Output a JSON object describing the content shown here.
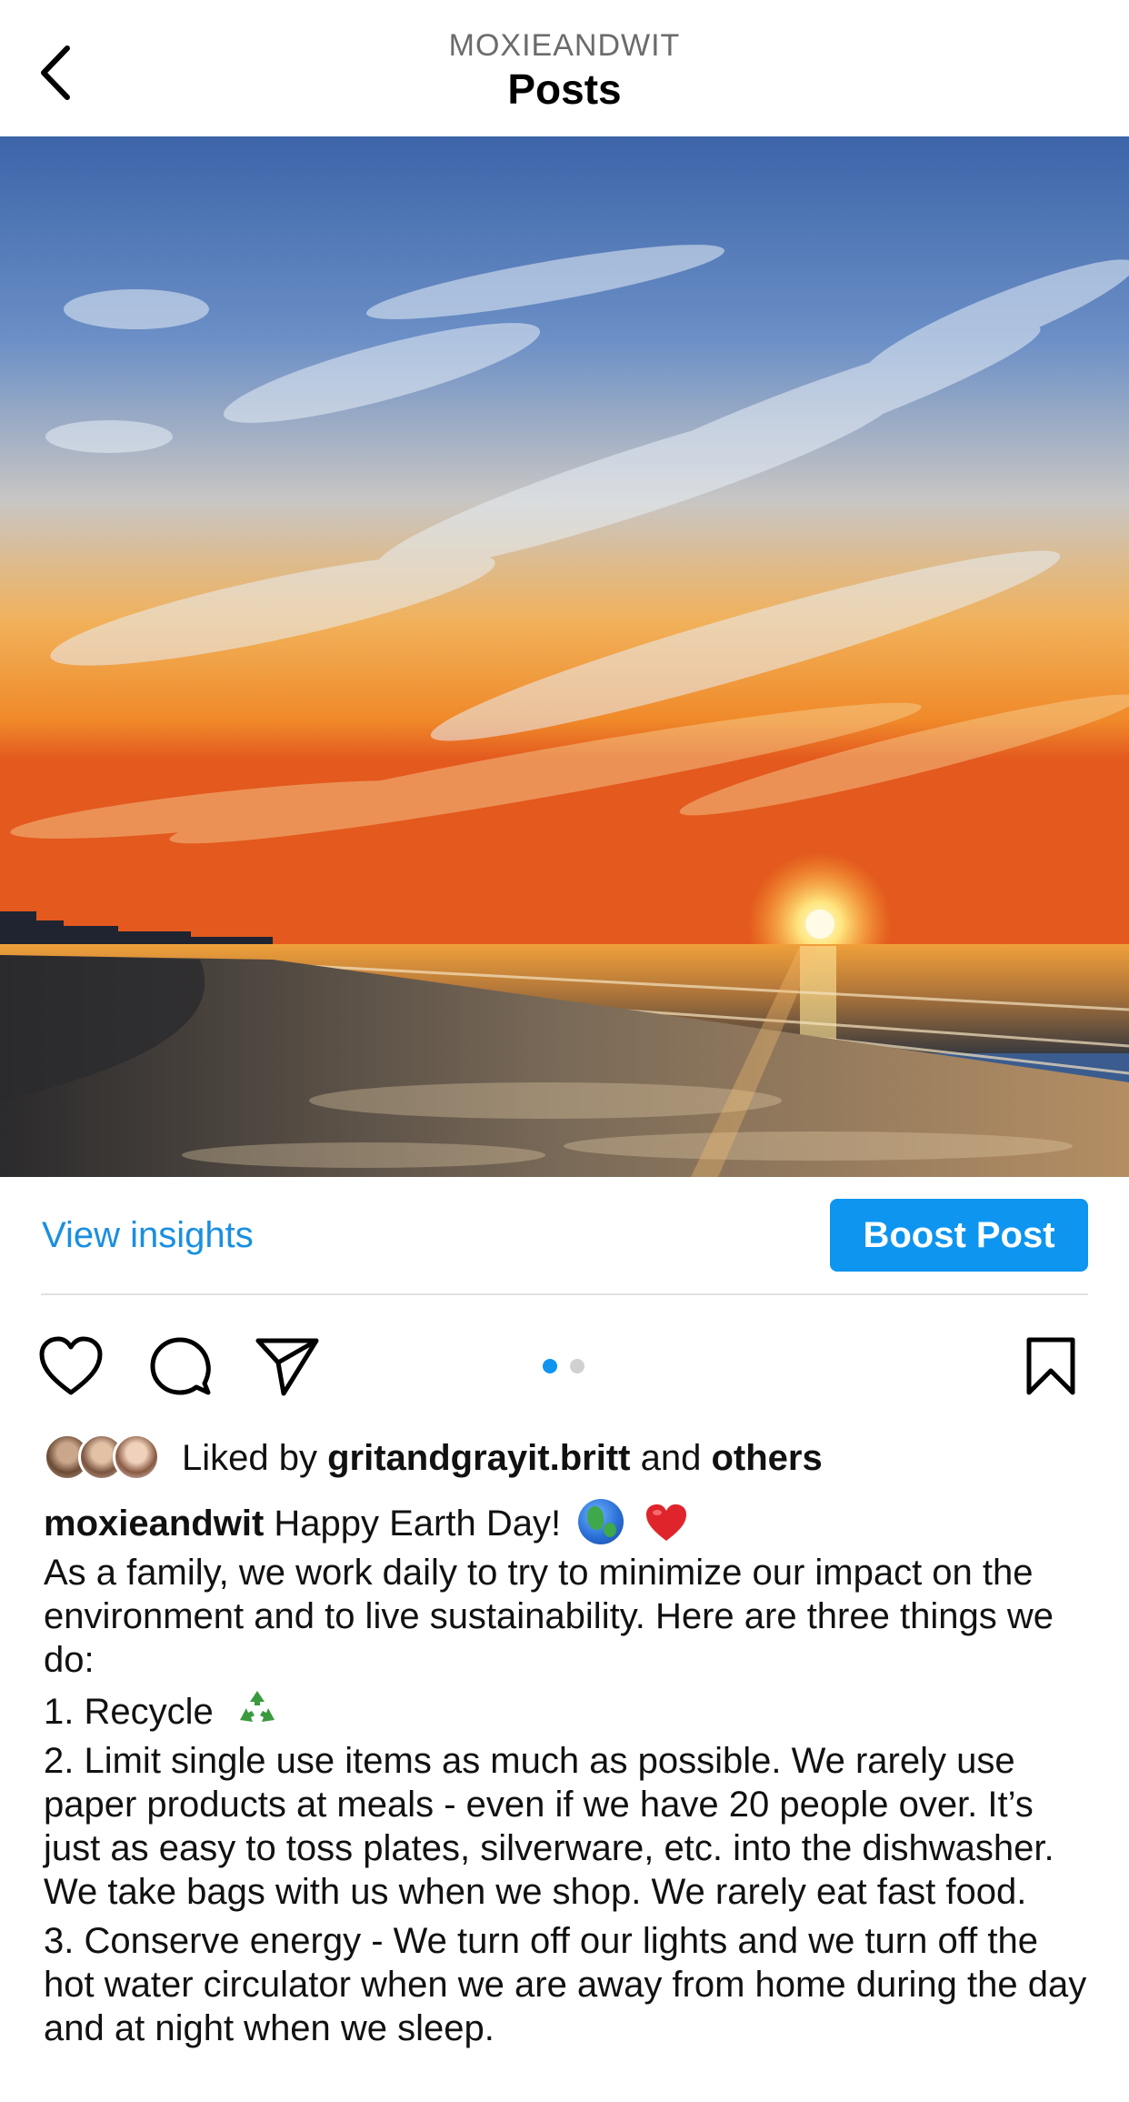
{
  "header": {
    "username": "MOXIEANDWIT",
    "title": "Posts",
    "back_icon": "chevron-left-icon"
  },
  "post": {
    "image_description_icon": "photo",
    "insights_label": "View insights",
    "boost_label": "Boost Post",
    "carousel": {
      "count": 2,
      "active_index": 0
    },
    "likes": {
      "prefix": "Liked by",
      "user": "gritandgrayit.britt",
      "conjunction": "and",
      "others": "others"
    },
    "caption": {
      "username": "moxieandwit",
      "headline": "Happy Earth Day!",
      "intro": "As a family, we work daily to try to minimize our impact on the environment and to live sustainability. Here are three things we do:",
      "item1": "1. Recycle",
      "item2": "2. Limit single use items as much as possible. We rarely use paper products at meals - even if we have 20 people over. It’s just as easy to toss plates, silverware, etc. into the dishwasher. We take bags with us when we shop. We rarely eat fast food.",
      "item3": "3. Conserve energy - We turn off our lights and we turn off the hot water circulator when we are away from home during the day and at night when we sleep."
    }
  },
  "colors": {
    "accent": "#0d95f0",
    "link": "#1a8fe0",
    "dot_active": "#0d95f0",
    "dot_inactive": "#d0d0d0"
  }
}
